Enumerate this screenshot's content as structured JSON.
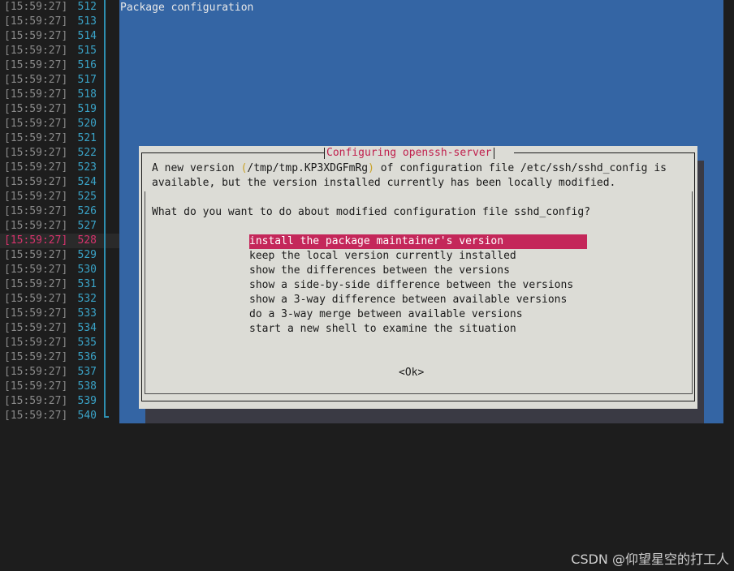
{
  "gutter": {
    "lines": [
      {
        "time": "[15:59:27]",
        "num": "512"
      },
      {
        "time": "[15:59:27]",
        "num": "513"
      },
      {
        "time": "[15:59:27]",
        "num": "514"
      },
      {
        "time": "[15:59:27]",
        "num": "515"
      },
      {
        "time": "[15:59:27]",
        "num": "516"
      },
      {
        "time": "[15:59:27]",
        "num": "517"
      },
      {
        "time": "[15:59:27]",
        "num": "518"
      },
      {
        "time": "[15:59:27]",
        "num": "519"
      },
      {
        "time": "[15:59:27]",
        "num": "520"
      },
      {
        "time": "[15:59:27]",
        "num": "521"
      },
      {
        "time": "[15:59:27]",
        "num": "522"
      },
      {
        "time": "[15:59:27]",
        "num": "523"
      },
      {
        "time": "[15:59:27]",
        "num": "524"
      },
      {
        "time": "[15:59:27]",
        "num": "525"
      },
      {
        "time": "[15:59:27]",
        "num": "526"
      },
      {
        "time": "[15:59:27]",
        "num": "527"
      },
      {
        "time": "[15:59:27]",
        "num": "528"
      },
      {
        "time": "[15:59:27]",
        "num": "529"
      },
      {
        "time": "[15:59:27]",
        "num": "530"
      },
      {
        "time": "[15:59:27]",
        "num": "531"
      },
      {
        "time": "[15:59:27]",
        "num": "532"
      },
      {
        "time": "[15:59:27]",
        "num": "533"
      },
      {
        "time": "[15:59:27]",
        "num": "534"
      },
      {
        "time": "[15:59:27]",
        "num": "535"
      },
      {
        "time": "[15:59:27]",
        "num": "536"
      },
      {
        "time": "[15:59:27]",
        "num": "537"
      },
      {
        "time": "[15:59:27]",
        "num": "538"
      },
      {
        "time": "[15:59:27]",
        "num": "539"
      },
      {
        "time": "[15:59:27]",
        "num": "540"
      }
    ],
    "highlighted_num": "528"
  },
  "terminal": {
    "header": "Package configuration"
  },
  "dialog": {
    "title": "Configuring openssh-server",
    "line1_a": "A new version ",
    "line1_paren_open": "(",
    "line1_path": "/tmp/tmp.KP3XDGFmRg",
    "line1_paren_close": ")",
    "line1_b": " of configuration file /etc/ssh/sshd_config is",
    "line2": "available, but the version installed currently has been locally modified.",
    "question": "What do you want to do about modified configuration file sshd_config?",
    "options": [
      "install the package maintainer's version",
      "keep the local version currently installed",
      "show the differences between the versions",
      "show a side-by-side difference between the versions",
      "show a 3-way difference between available versions",
      "do a 3-way merge between available versions",
      "start a new shell to examine the situation"
    ],
    "selected_option": "install the package maintainer's version",
    "ok_label": "<Ok>"
  },
  "watermark": "CSDN @仰望星空的打工人",
  "colors": {
    "terminal_bg": "#3465a4",
    "dialog_bg": "#dcdcd6",
    "selection": "#c4275a",
    "title_accent": "#c0204d",
    "line_number": "#3aa3c7"
  }
}
